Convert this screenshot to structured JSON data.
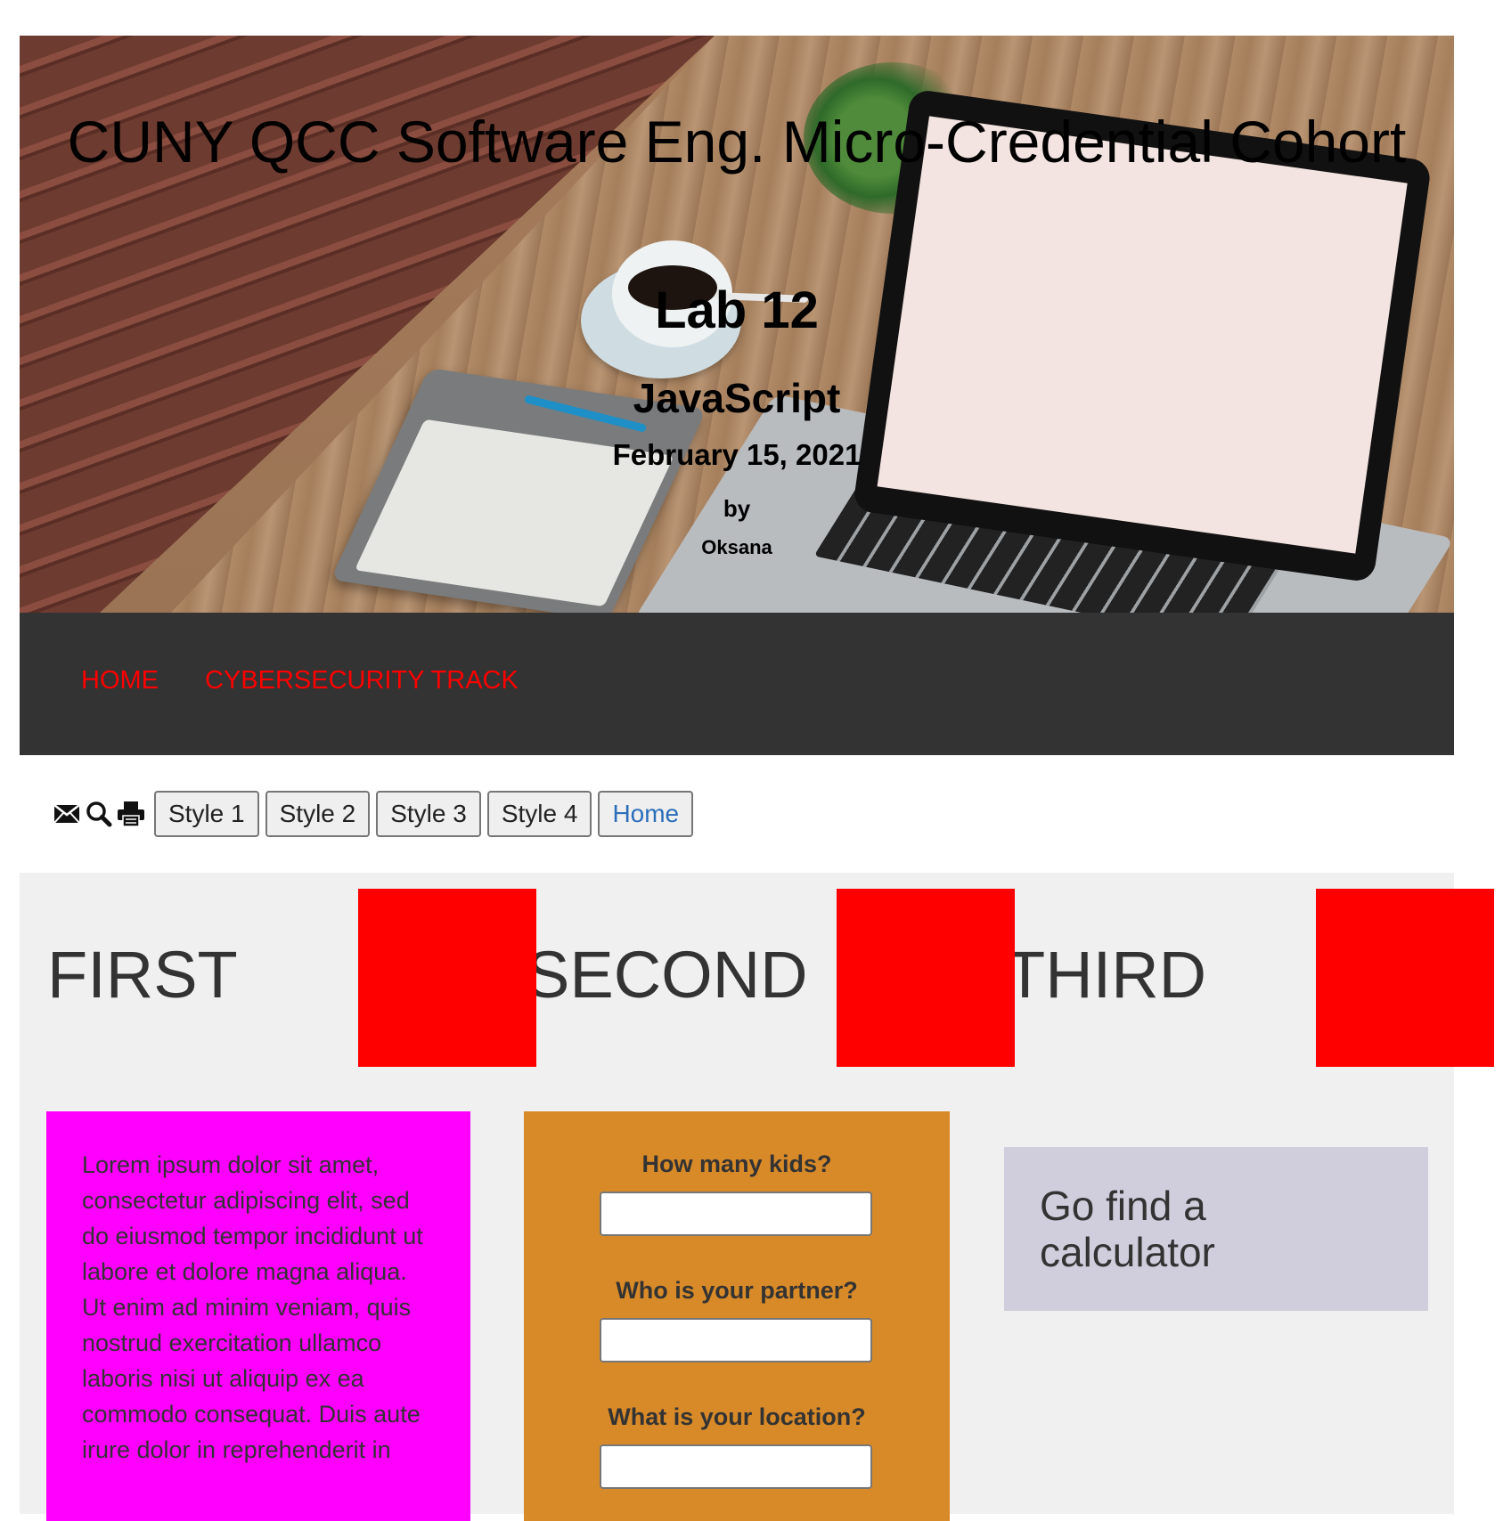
{
  "header": {
    "title": "CUNY QCC Software Eng. Micro-Credential Cohort",
    "lab": "Lab 12",
    "subject": "JavaScript",
    "date": "February 15, 2021",
    "by": "by",
    "author": "Oksana"
  },
  "nav": {
    "items": [
      {
        "label": "HOME"
      },
      {
        "label": "CYBERSECURITY TRACK"
      }
    ],
    "link_color": "#ff0000",
    "background": "#333333"
  },
  "toolbar": {
    "icons": [
      "envelope-icon",
      "search-icon",
      "print-icon"
    ],
    "buttons": [
      {
        "label": "Style 1"
      },
      {
        "label": "Style 2"
      },
      {
        "label": "Style 3"
      },
      {
        "label": "Style 4"
      },
      {
        "label": "Home"
      }
    ]
  },
  "columns": {
    "titles": [
      "FIRST",
      "SECOND",
      "THIRD"
    ],
    "square_color": "#ff0000"
  },
  "card_first": {
    "text": "Lorem ipsum dolor sit amet, consectetur adipiscing elit, sed do eiusmod tempor incididunt ut labore et dolore magna aliqua. Ut enim ad minim veniam, quis nostrud exercitation ullamco laboris nisi ut aliquip ex ea commodo consequat. Duis aute irure dolor in reprehenderit in",
    "background": "#ff00ff"
  },
  "card_form": {
    "background": "#d98a28",
    "fields": [
      {
        "label": "How many kids?",
        "value": ""
      },
      {
        "label": "Who is your partner?",
        "value": ""
      },
      {
        "label": "What is your location?",
        "value": ""
      }
    ]
  },
  "card_third": {
    "text": "Go find a calculator",
    "background": "#d0cedd"
  }
}
